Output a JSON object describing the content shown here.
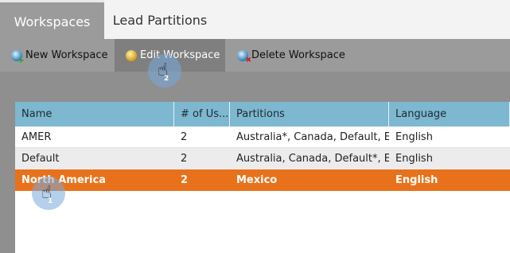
{
  "tabs": [
    {
      "label": "Workspaces",
      "active": true
    },
    {
      "label": "Lead Partitions",
      "active": false
    }
  ],
  "toolbar": {
    "new_label": "New Workspace",
    "edit_label": "Edit Workspace",
    "delete_label": "Delete Workspace"
  },
  "table": {
    "columns": [
      "Name",
      "# of Us...",
      "Partitions",
      "Language"
    ],
    "rows": [
      {
        "name": "AMER",
        "users": "2",
        "partitions": "Australia*, Canada, Default, E...",
        "language": "English"
      },
      {
        "name": "Default",
        "users": "2",
        "partitions": "Australia, Canada, Default*, E...",
        "language": "English"
      },
      {
        "name": "North America",
        "users": "2",
        "partitions": "Mexico",
        "language": "English",
        "selected": true
      }
    ]
  },
  "callouts": {
    "step1": "1",
    "step2": "2"
  },
  "colors": {
    "accent_selected_row": "#e8721c",
    "header_bg": "#7db7d0",
    "toolbar_bg": "#9b9b9b"
  }
}
